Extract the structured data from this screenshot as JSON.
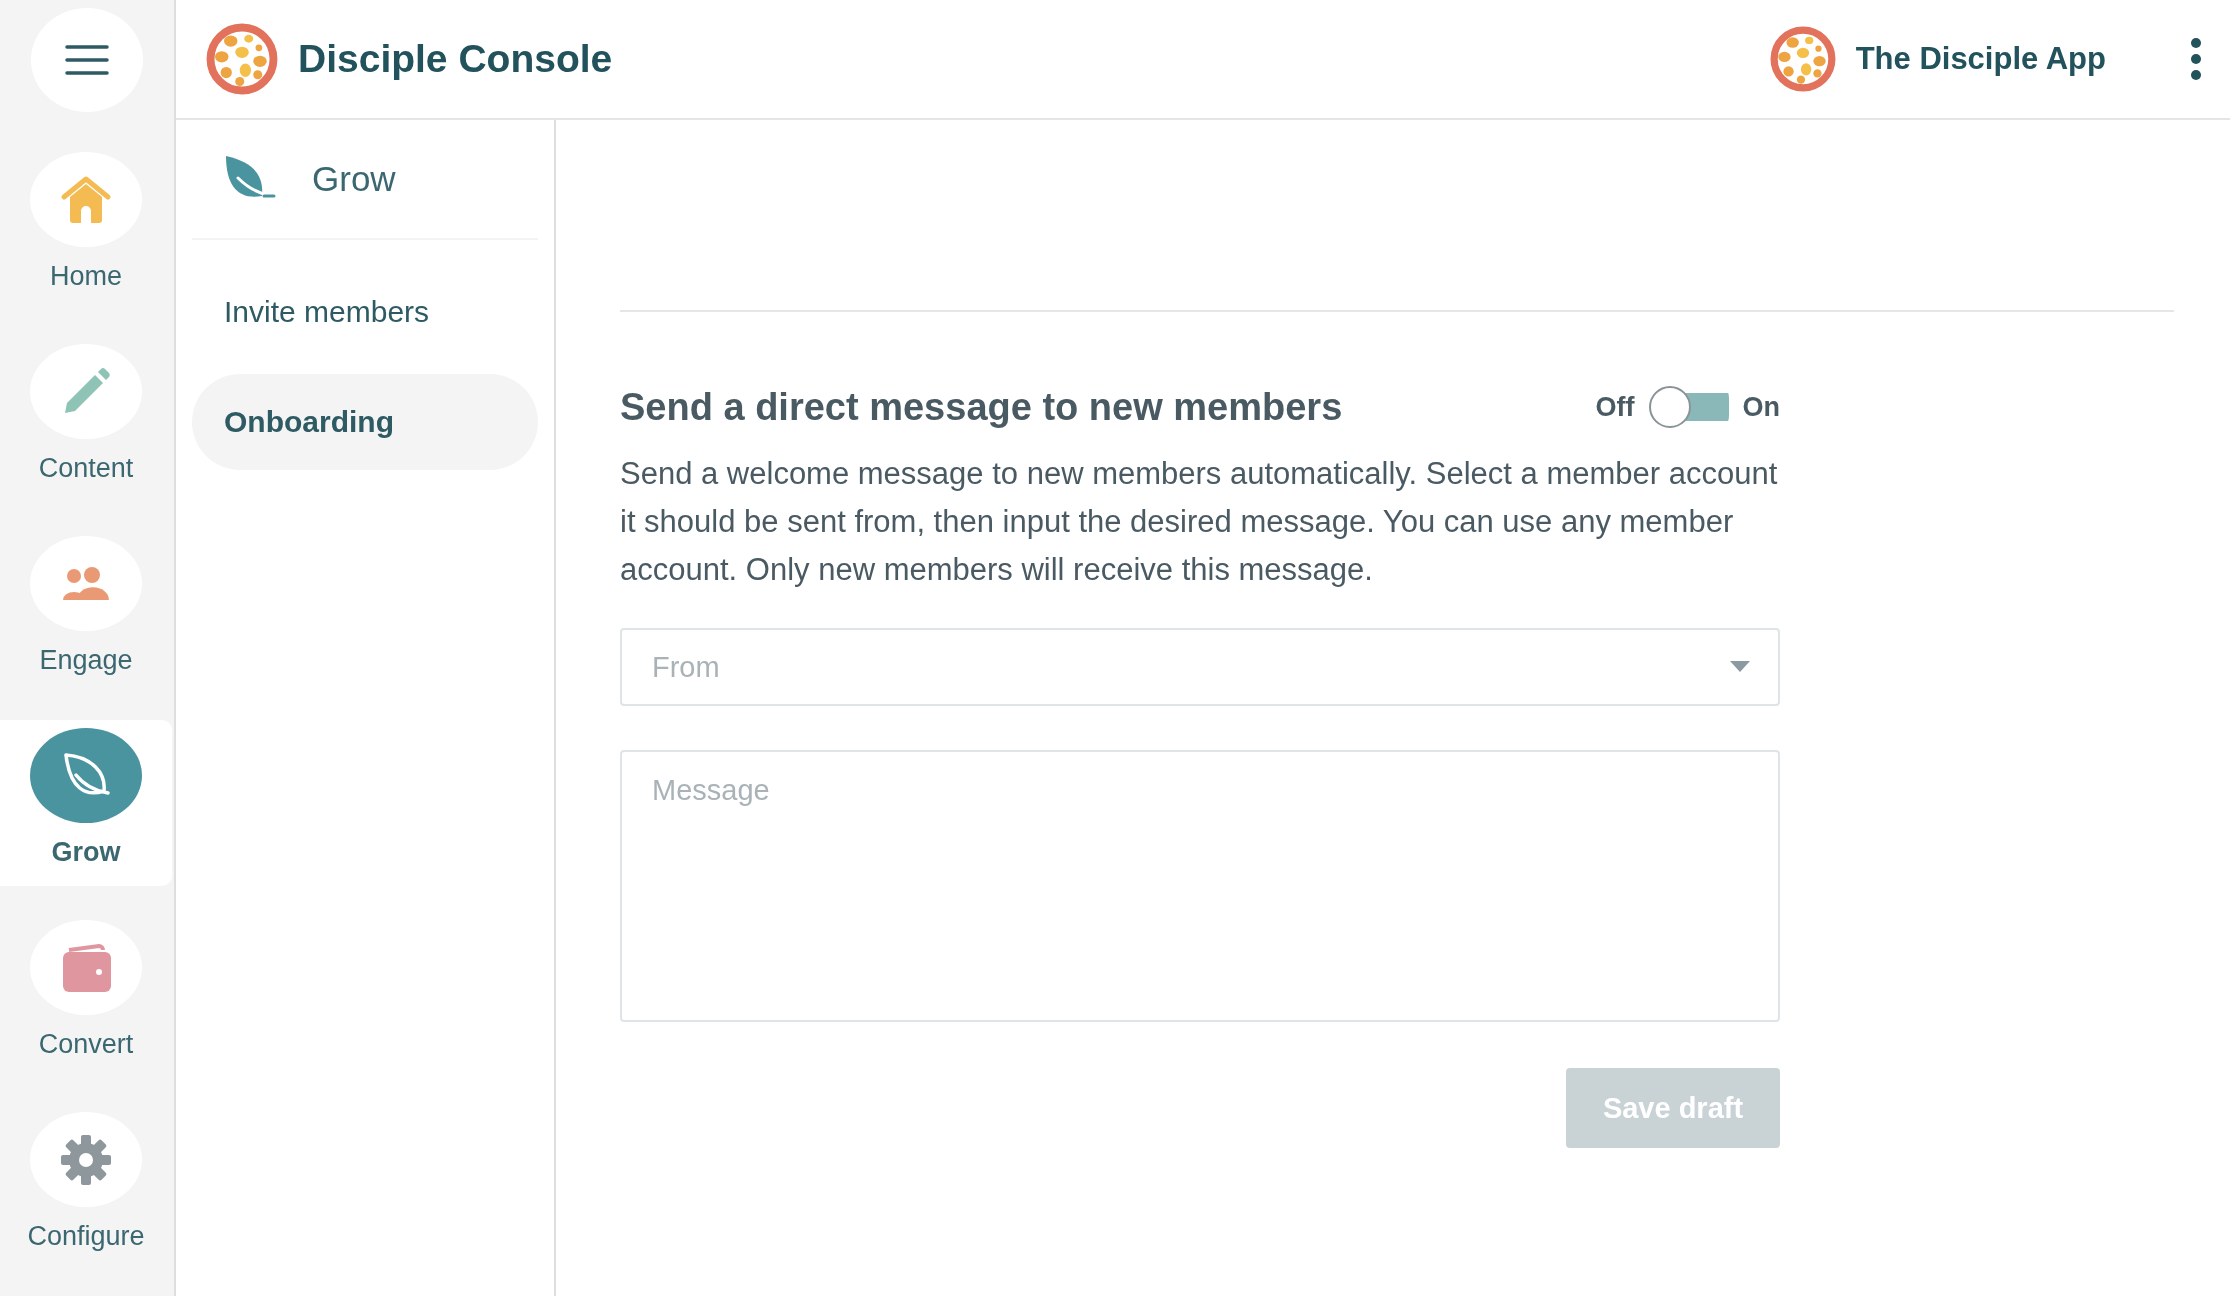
{
  "header": {
    "title": "Disciple Console",
    "app_name": "The Disciple App"
  },
  "rail": [
    {
      "label": "Home",
      "selected": false
    },
    {
      "label": "Content",
      "selected": false
    },
    {
      "label": "Engage",
      "selected": false
    },
    {
      "label": "Grow",
      "selected": true
    },
    {
      "label": "Convert",
      "selected": false
    },
    {
      "label": "Configure",
      "selected": false
    }
  ],
  "submenu": {
    "title": "Grow",
    "items": [
      {
        "label": "Invite members",
        "selected": false
      },
      {
        "label": "Onboarding",
        "selected": true
      }
    ]
  },
  "section": {
    "title": "Send a direct message to new members",
    "toggle": {
      "off_label": "Off",
      "on_label": "On",
      "on": false
    },
    "description": "Send a welcome message to new members automatically. Select a member account it should be sent from, then input the desired message. You can use any member account. Only new members will receive this message.",
    "from": {
      "placeholder": "From"
    },
    "message": {
      "placeholder": "Message"
    },
    "save_button": {
      "label": "Save draft",
      "disabled": true
    }
  }
}
